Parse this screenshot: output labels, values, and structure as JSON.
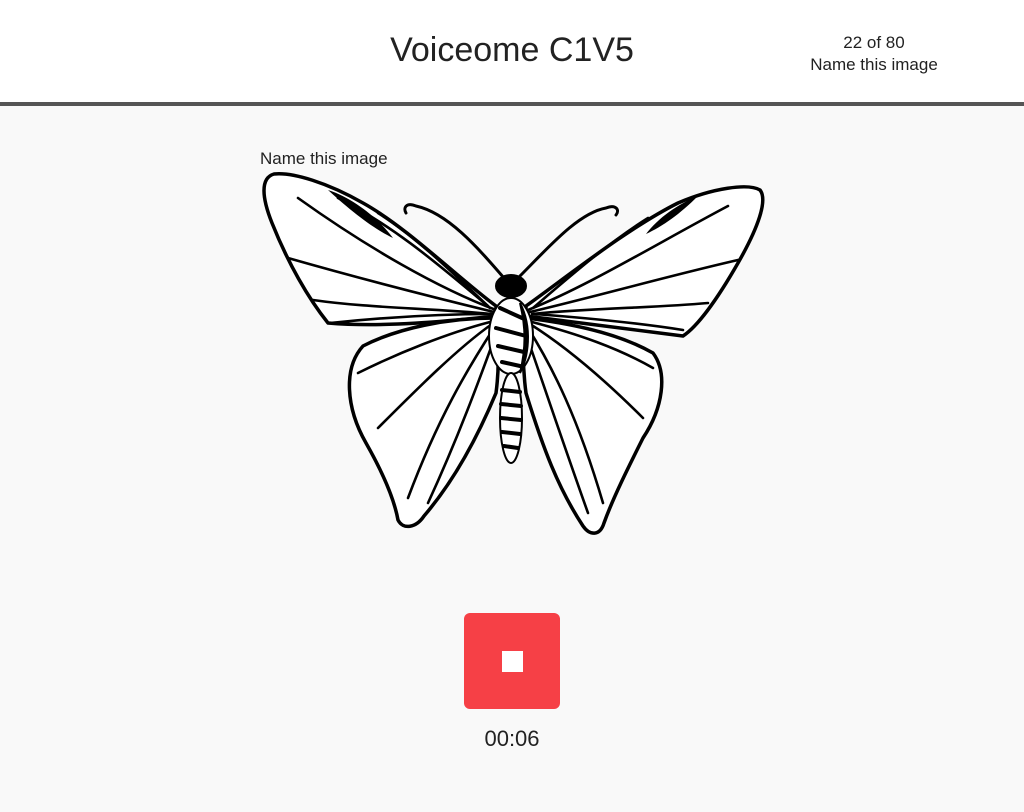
{
  "header": {
    "title": "Voiceome C1V5",
    "progress_count": "22 of 80",
    "progress_task": "Name this image"
  },
  "task": {
    "prompt": "Name this image",
    "stimulus_icon": "butterfly-line-drawing"
  },
  "recorder": {
    "stop_icon": "stop-icon",
    "elapsed": "00:06",
    "button_color": "#f64046"
  }
}
